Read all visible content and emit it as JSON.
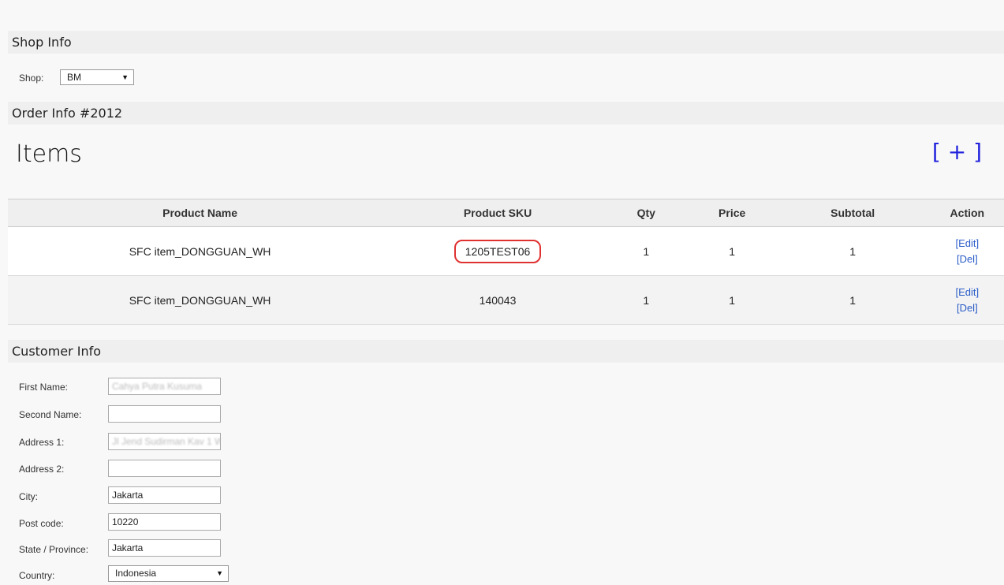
{
  "shop_info": {
    "heading": "Shop Info",
    "shop_label": "Shop:",
    "shop_value": "BM"
  },
  "order_info": {
    "heading": "Order Info #2012"
  },
  "items": {
    "title": "Items",
    "add_label": "[ + ]",
    "columns": [
      "Product Name",
      "Product SKU",
      "Qty",
      "Price",
      "Subtotal",
      "Action"
    ],
    "rows": [
      {
        "name": "SFC item_DONGGUAN_WH",
        "sku": "1205TEST06",
        "qty": "1",
        "price": "1",
        "subtotal": "1",
        "edit": "[Edit]",
        "del": "[Del]"
      },
      {
        "name": "SFC item_DONGGUAN_WH",
        "sku": "140043",
        "qty": "1",
        "price": "1",
        "subtotal": "1",
        "edit": "[Edit]",
        "del": "[Del]"
      }
    ]
  },
  "customer_info": {
    "heading": "Customer Info",
    "fields": [
      {
        "label": "First Name:",
        "value": "Cahya Putra Kusuma"
      },
      {
        "label": "Second Name:",
        "value": ""
      },
      {
        "label": "Address 1:",
        "value": "Jl Jend Sudirman Kav 1 W"
      },
      {
        "label": "Address 2:",
        "value": ""
      },
      {
        "label": "City:",
        "value": "Jakarta"
      },
      {
        "label": "Post code:",
        "value": "10220"
      },
      {
        "label": "State / Province:",
        "value": "Jakarta"
      },
      {
        "label": "Country:",
        "value": "Indonesia"
      }
    ]
  },
  "colors": {
    "accent_link": "#2222dd",
    "highlight_circle": "#e03131"
  }
}
